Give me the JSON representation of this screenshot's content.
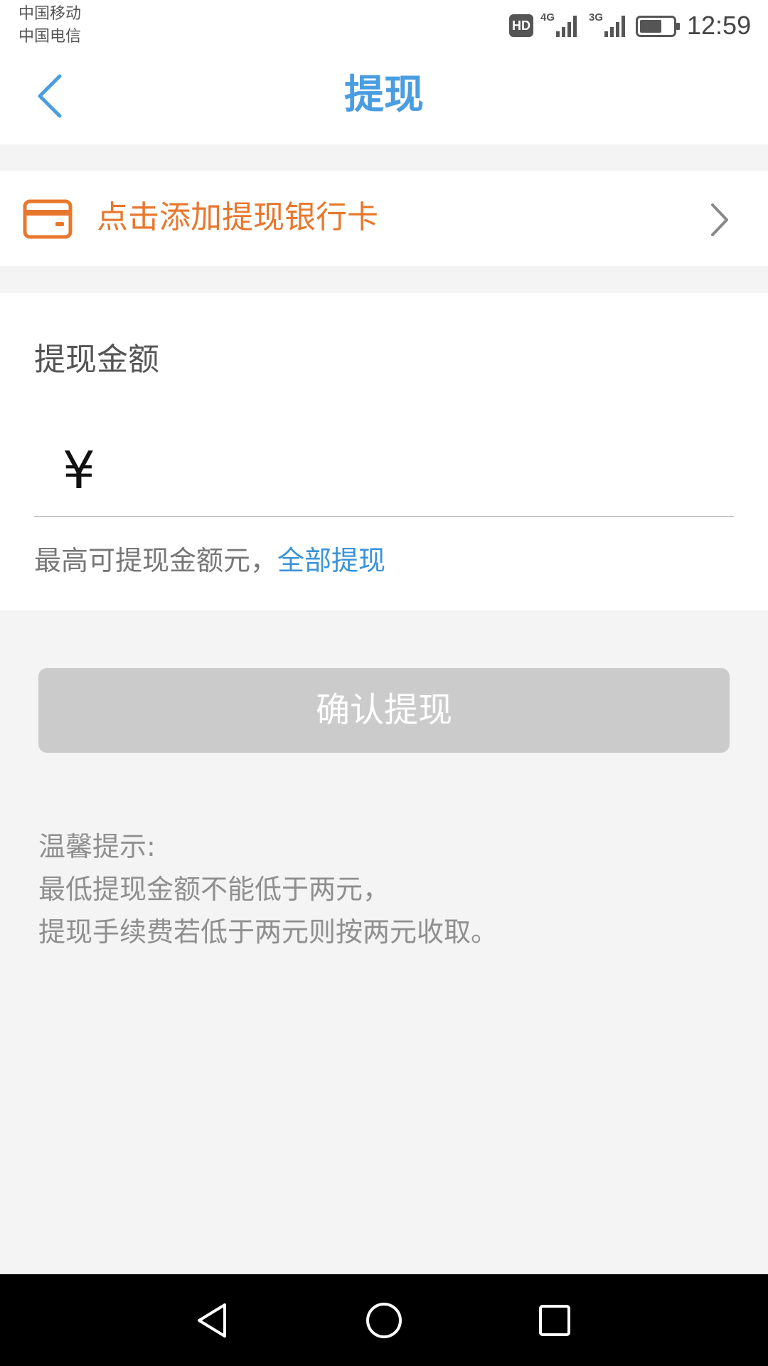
{
  "status_bar": {
    "carrier_1": "中国移动",
    "carrier_2": "中国电信",
    "hd_badge": "HD",
    "network_1": "4G",
    "network_2": "3G",
    "time": "12:59"
  },
  "header": {
    "title": "提现",
    "back_icon": "chevron-left-icon"
  },
  "bank_card": {
    "label": "点击添加提现银行卡",
    "icon": "card-icon",
    "chevron_icon": "chevron-right-icon"
  },
  "amount": {
    "label": "提现金额",
    "currency_symbol": "¥",
    "input_value": "",
    "max_text": "最高可提现金额元，",
    "withdraw_all": "全部提现"
  },
  "confirm_button": {
    "label": "确认提现"
  },
  "tips": {
    "title": "温馨提示:",
    "line1": "最低提现金额不能低于两元，",
    "line2": "提现手续费若低于两元则按两元收取。"
  },
  "system_nav": {
    "back": "triangle-back-icon",
    "home": "circle-home-icon",
    "recents": "square-recents-icon"
  },
  "colors": {
    "title_blue": "#4a9de0",
    "bank_orange": "#e8772e",
    "link_blue": "#3a93d8",
    "button_disabled": "#cbcbcb"
  }
}
